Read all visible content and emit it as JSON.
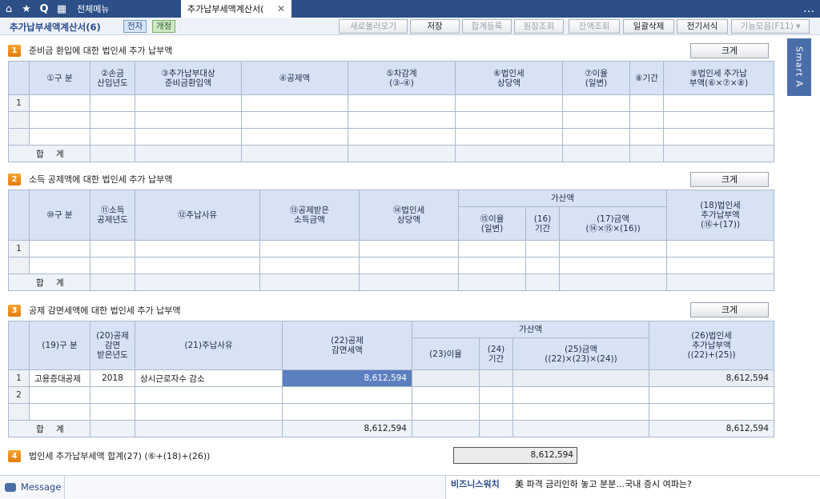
{
  "tabs": {
    "menu": "전체메뉴",
    "active": "추가납부세액계산서("
  },
  "toolbar": {
    "title": "추가납부세액계산서(6)",
    "chip_e": "전자",
    "chip_g": "개정",
    "buttons": [
      "새로불러오기",
      "저장",
      "합계등록",
      "원장조회",
      "잔액조회",
      "일괄삭제",
      "전기서식",
      "기능모음(F11)"
    ]
  },
  "side_tab": "Smart A",
  "size_btn": "크게",
  "sec1": {
    "num": "1",
    "title": "준비금 환입에 대한 법인세 추가 납부액",
    "headers": [
      "①구  분",
      "②손금\n산입년도",
      "③추가납부대상\n준비금환입액",
      "④공제액",
      "⑤차감계\n(③-④)",
      "⑥법인세\n상당액",
      "⑦이율\n(일변)",
      "⑧기간",
      "⑨법인세 추가납\n부액(⑥×⑦×⑧)"
    ],
    "row_no": "1",
    "sum_label": "합  계"
  },
  "sec2": {
    "num": "2",
    "title": "소득 공제액에 대한 법인세 추가 납부액",
    "headers": {
      "h1": "⑩구  분",
      "h2": "⑪소득\n공제년도",
      "h3": "⑫추납사유",
      "h4": "⑬공제받은\n소득금액",
      "h5": "⑭법인세\n상당액",
      "group": "가산액",
      "g1": "⑮이율\n(일변)",
      "g2": "(16)\n기간",
      "g3": "(17)금액\n(⑭×⑮×(16))",
      "h6": "(18)법인세\n추가납부액\n(⑯+(17))"
    },
    "row_no": "1",
    "sum_label": "합  계"
  },
  "sec3": {
    "num": "3",
    "title": "공제 감면세액에 대한 법인세 추가 납부액",
    "headers": {
      "h1": "(19)구  분",
      "h2": "(20)공제\n감면\n받은년도",
      "h3": "(21)추납사유",
      "h4": "(22)공제\n감면세액",
      "group": "가산액",
      "g1": "(23)이율",
      "g2": "(24)\n기간",
      "g3": "(25)금액\n((22)×(23)×(24))",
      "h5": "(26)법인세\n추가납부액\n((22)+(25))"
    },
    "rows": [
      {
        "no": "1",
        "type": "고용증대공제",
        "year": "2018",
        "reason": "상시근로자수 감소",
        "amount": "8,612,594",
        "total": "8,612,594"
      },
      {
        "no": "2",
        "type": "",
        "year": "",
        "reason": "",
        "amount": "",
        "total": ""
      }
    ],
    "sum_label": "합  계",
    "sum_amount": "8,612,594",
    "sum_total": "8,612,594"
  },
  "sec4": {
    "num": "4",
    "title": "법인세 추가납부세액 합계(27) (⑥+(18)+(26))",
    "value": "8,612,594"
  },
  "status": {
    "message": "Message",
    "news_label": "비즈니스워치",
    "news_text": "美 파격 금리인하 놓고 분분…국내 증시 여파는?"
  },
  "colors": {
    "tabbar": "#2b4f86",
    "header_cell": "#d7e3f5",
    "selected_cell": "#5b7fbf",
    "section_badge": "#f08c1e"
  }
}
